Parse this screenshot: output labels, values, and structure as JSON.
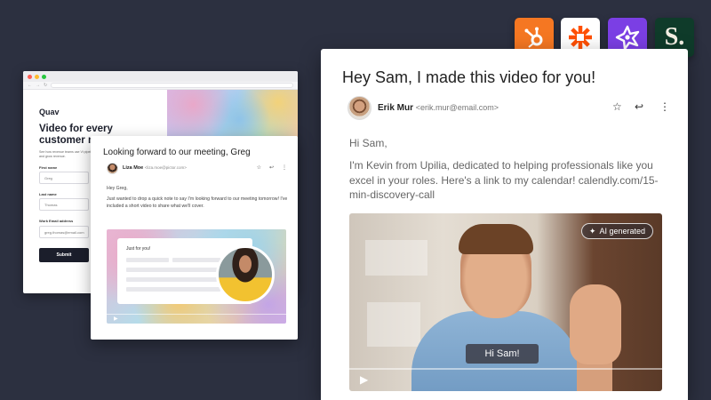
{
  "colors": {
    "background": "#2c3040",
    "hubspot": "#f57722",
    "zapier_bg": "#ffffff",
    "zapier": "#ff4f00",
    "purple_app": "#7b3fe4",
    "s_app": "#0f3b2a",
    "mac_red": "#ff5f57",
    "mac_yellow": "#febc2e",
    "mac_green": "#28c840"
  },
  "app_icons": [
    "hubspot-icon",
    "zapier-icon",
    "sparkle-app-icon",
    "s-letter-icon"
  ],
  "s_app_letter": "S.",
  "browser": {
    "logo": "Quav",
    "hero_title": "Video for every customer m",
    "hero_subtitle": "See how revenue teams use Vi pipeline, and grow revenue.",
    "first_name_label": "First name",
    "first_name_value": "Greg",
    "last_name_label": "Last name",
    "last_name_value": "Thomas",
    "email_label": "Work Email address",
    "email_value": "greg.thomas@email.com",
    "submit_label": "Submit"
  },
  "mid_email": {
    "subject": "Looking forward to our meeting, Greg",
    "sender_name": "Liza Moe",
    "sender_email": "<liza.moe@pictor.com>",
    "greeting": "Hey Greg,",
    "body": "Just wanted to drop a quick note to say I'm looking forward to our meeting tomorrow! I've included a short video to share what we'll cover.",
    "card_label": "Just for you!"
  },
  "front_email": {
    "subject": "Hey Sam, I made this video for you!",
    "sender_name": "Erik Mur",
    "sender_email": "<erik.mur@email.com>",
    "greeting": "Hi Sam,",
    "body": "I'm Kevin from Upilia, dedicated to helping professionals like you excel in your roles. Here's a link to my calendar! calendly.com/15-min-discovery-call",
    "ai_badge": "AI generated",
    "caption": "Hi Sam!"
  }
}
